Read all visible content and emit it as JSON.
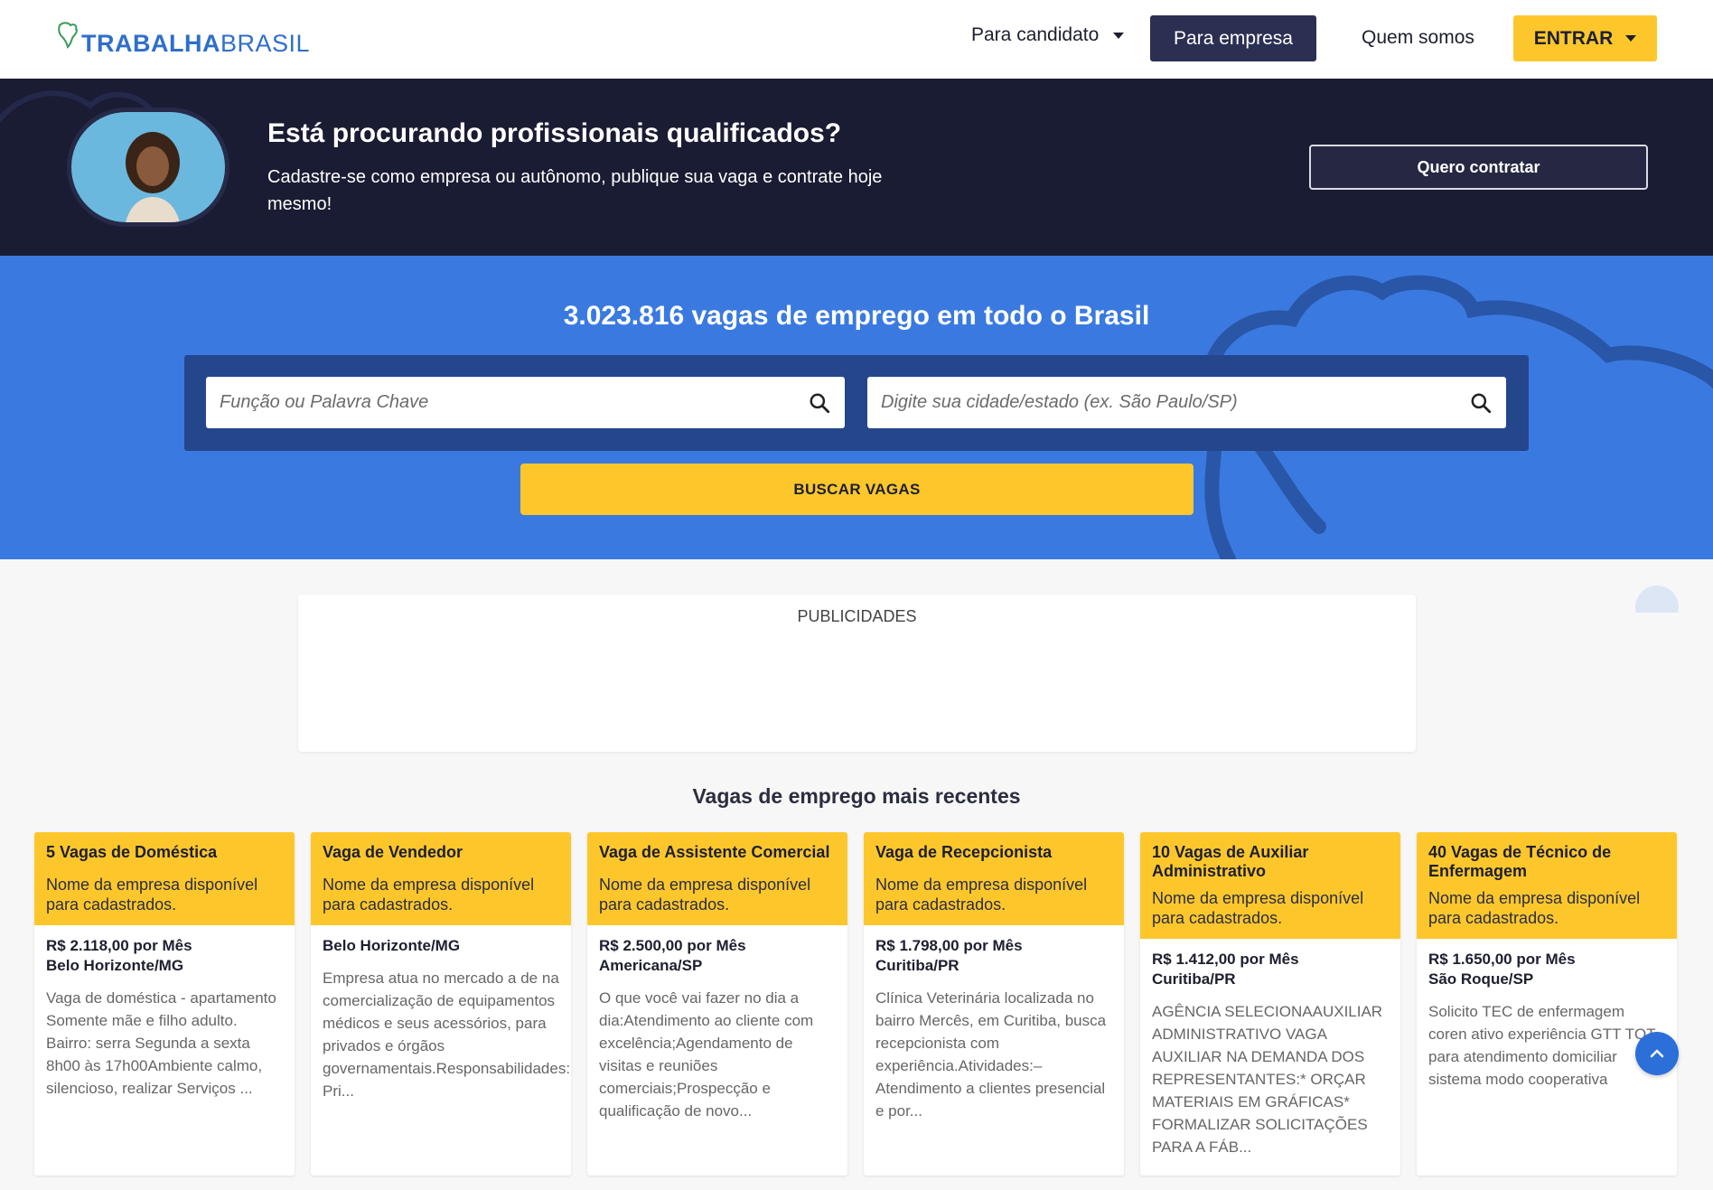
{
  "brand": {
    "logo_bold": "TRABALHA",
    "logo_light": "BRASIL"
  },
  "nav": {
    "candidate_label": "Para candidato",
    "company_label": "Para empresa",
    "about_label": "Quem somos",
    "login_label": "ENTRAR"
  },
  "promo": {
    "title": "Está procurando profissionais qualificados?",
    "subtitle": "Cadastre-se como empresa ou autônomo, publique sua vaga e contrate hoje mesmo!",
    "cta_label": "Quero contratar"
  },
  "search": {
    "title": "3.023.816 vagas de emprego em todo o Brasil",
    "keyword_placeholder": "Função ou Palavra Chave",
    "location_placeholder": "Digite sua cidade/estado (ex. São Paulo/SP)",
    "button_label": "BUSCAR VAGAS"
  },
  "ads": {
    "label": "PUBLICIDADES"
  },
  "recent": {
    "title": "Vagas de emprego mais recentes",
    "jobs": [
      {
        "title": "5 Vagas de Doméstica",
        "company": "Nome da empresa disponível para cadastrados.",
        "salary": "R$ 2.118,00 por Mês",
        "location": "Belo Horizonte/MG",
        "description": "Vaga de doméstica - apartamento Somente mãe e filho adulto. Bairro: serra Segunda a sexta 8h00 às 17h00Ambiente calmo, silencioso, realizar Serviços ..."
      },
      {
        "title": "Vaga de Vendedor",
        "company": "Nome da empresa disponível para cadastrados.",
        "salary": "",
        "location": "Belo Horizonte/MG",
        "description": "Empresa atua no mercado a de na comercialização de equipamentos médicos e seus acessórios, para privados e órgãos governamentais.Responsabilidades: Pri..."
      },
      {
        "title": "Vaga de Assistente Comercial",
        "company": "Nome da empresa disponível para cadastrados.",
        "salary": "R$ 2.500,00 por Mês",
        "location": "Americana/SP",
        "description": "O que você vai fazer no dia a dia:Atendimento ao cliente com excelência;Agendamento de visitas e reuniões comerciais;Prospecção e qualificação de novo..."
      },
      {
        "title": "Vaga de Recepcionista",
        "company": "Nome da empresa disponível para cadastrados.",
        "salary": "R$ 1.798,00 por Mês",
        "location": "Curitiba/PR",
        "description": "Clínica Veterinária localizada no bairro Mercês, em Curitiba, busca recepcionista com experiência.Atividades:– Atendimento a clientes presencial e por..."
      },
      {
        "title": "10 Vagas de Auxiliar Administrativo",
        "company": "Nome da empresa disponível para cadastrados.",
        "salary": "R$ 1.412,00 por Mês",
        "location": "Curitiba/PR",
        "description": "AGÊNCIA SELECIONAAUXILIAR ADMINISTRATIVO VAGA AUXILIAR NA DEMANDA DOS REPRESENTANTES:* ORÇAR MATERIAIS EM GRÁFICAS* FORMALIZAR SOLICITAÇÕES PARA A FÁB..."
      },
      {
        "title": "40 Vagas de Técnico de Enfermagem",
        "company": "Nome da empresa disponível para cadastrados.",
        "salary": "R$ 1.650,00 por Mês",
        "location": "São Roque/SP",
        "description": "Solicito TEC de enfermagem coren ativo experiência GTT TQT para atendimento domiciliar sistema modo cooperativa"
      }
    ]
  },
  "colors": {
    "navy": "#1a1c33",
    "brand_blue": "#3a7ae0",
    "accent_yellow": "#fdc72c",
    "button_dark": "#2b2f52"
  },
  "icons": [
    "brazil-map-logo-icon",
    "chevron-down-icon",
    "search-icon",
    "arrow-up-icon"
  ]
}
